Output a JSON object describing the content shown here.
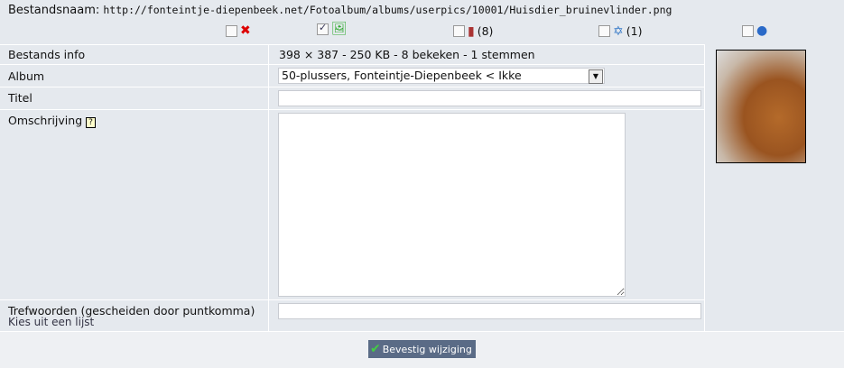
{
  "header": {
    "label": "Bestandsnaam:",
    "url": "http://fonteintje-diepenbeek.net/Fotoalbum/albums/userpics/10001/Huisdier_bruinevlinder.png"
  },
  "actions": [
    {
      "icon": "delete-icon",
      "checked": false,
      "count": ""
    },
    {
      "icon": "approve-image-icon",
      "checked": true,
      "count": ""
    },
    {
      "icon": "reset-views-icon",
      "checked": false,
      "count": "(8)"
    },
    {
      "icon": "reset-votes-icon",
      "checked": false,
      "count": "(1)"
    },
    {
      "icon": "delete-comments-icon",
      "checked": false,
      "count": ""
    }
  ],
  "rows": {
    "info_label": "Bestands info",
    "info_value": "398 × 387 - 250 KB - 8 bekeken - 1 stemmen",
    "album_label": "Album",
    "album_value": "50-plussers, Fonteintje-Diepenbeek < Ikke",
    "title_label": "Titel",
    "title_value": "",
    "desc_label": "Omschrijving",
    "desc_help": "?",
    "desc_value": "",
    "keywords_label": "Trefwoorden (gescheiden door puntkomma)",
    "keywords_link": "Kies uit een lijst",
    "keywords_value": ""
  },
  "submit_label": "Bevestig wijziging"
}
